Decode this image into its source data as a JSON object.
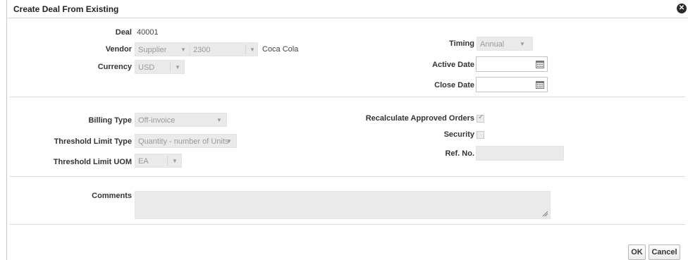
{
  "dialog": {
    "title": "Create Deal From Existing",
    "close_icon": "close-icon"
  },
  "header": {
    "deal_label": "Deal",
    "deal_value": "40001",
    "vendor_label": "Vendor",
    "vendor_type": "Supplier",
    "vendor_number": "2300",
    "vendor_name": "Coca Cola",
    "currency_label": "Currency",
    "currency_value": "USD",
    "timing_label": "Timing",
    "timing_value": "Annual",
    "active_date_label": "Active Date",
    "active_date_value": "",
    "close_date_label": "Close Date",
    "close_date_value": ""
  },
  "billing": {
    "billing_type_label": "Billing Type",
    "billing_type_value": "Off-invoice",
    "threshold_limit_type_label": "Threshold Limit Type",
    "threshold_limit_type_value": "Quantity - number of Units",
    "threshold_limit_uom_label": "Threshold Limit UOM",
    "threshold_limit_uom_value": "EA",
    "recalculate_label": "Recalculate Approved Orders",
    "recalculate_checked": true,
    "security_label": "Security",
    "security_checked": false,
    "ref_no_label": "Ref. No.",
    "ref_no_value": ""
  },
  "comments": {
    "label": "Comments",
    "value": ""
  },
  "footer": {
    "ok_label": "OK",
    "cancel_label": "Cancel"
  }
}
